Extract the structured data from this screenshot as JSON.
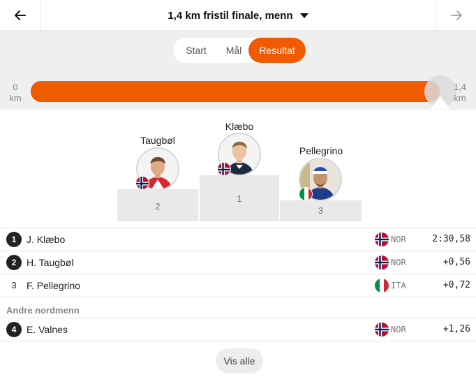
{
  "header": {
    "title": "1,4 km fristil finale, menn",
    "back_icon": "arrow-left-icon",
    "forward_icon": "arrow-right-icon",
    "dropdown_icon": "caret-down-icon"
  },
  "tabs": [
    {
      "label": "Start",
      "active": false
    },
    {
      "label": "Mål",
      "active": false
    },
    {
      "label": "Resultat",
      "active": true
    }
  ],
  "progress": {
    "start_value": "0",
    "start_unit": "km",
    "end_value": "1,4",
    "end_unit": "km",
    "fraction": 1.0
  },
  "podium": [
    {
      "name": "Klæbo",
      "place": "1",
      "country": "NOR"
    },
    {
      "name": "Taugbøl",
      "place": "2",
      "country": "NOR"
    },
    {
      "name": "Pellegrino",
      "place": "3",
      "country": "ITA"
    }
  ],
  "results": [
    {
      "rank": "1",
      "name": "J. Klæbo",
      "nation": "NOR",
      "time": "2:30,58",
      "badge": true
    },
    {
      "rank": "2",
      "name": "H. Taugbøl",
      "nation": "NOR",
      "time": "+0,56",
      "badge": true
    },
    {
      "rank": "3",
      "name": "F. Pellegrino",
      "nation": "ITA",
      "time": "+0,72",
      "badge": false
    }
  ],
  "other_section": {
    "heading": "Andre nordmenn",
    "results": [
      {
        "rank": "4",
        "name": "E. Valnes",
        "nation": "NOR",
        "time": "+1,26",
        "badge": true
      }
    ]
  },
  "show_all_label": "Vis alle",
  "colors": {
    "accent": "#f05a00",
    "band": "#efefef",
    "podium": "#e9e9e9"
  }
}
